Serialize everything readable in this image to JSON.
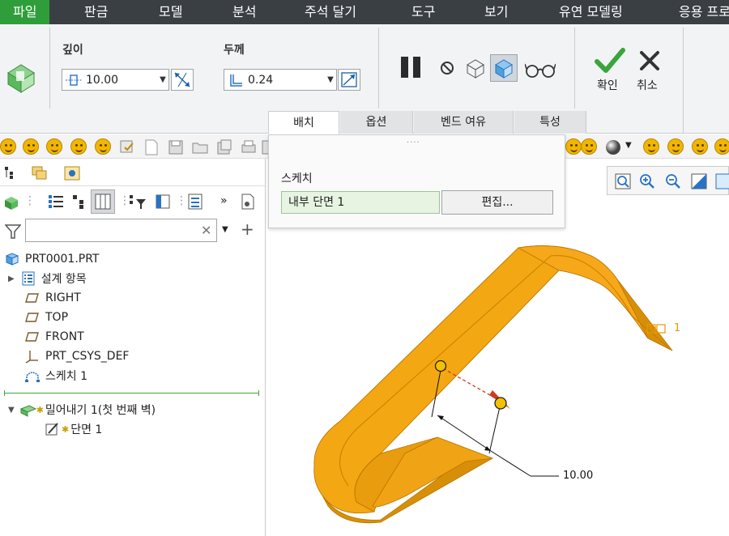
{
  "menubar": {
    "items": [
      "파일",
      "판금",
      "모델",
      "분석",
      "주석 달기",
      "도구",
      "보기",
      "유연 모델링",
      "응용 프로"
    ]
  },
  "ribbon": {
    "depth_label": "깊이",
    "depth_value": "10.00",
    "thickness_label": "두께",
    "thickness_value": "0.24",
    "ok_label": "확인",
    "cancel_label": "취소",
    "tabs": [
      "배치",
      "옵션",
      "벤드 여유",
      "특성"
    ]
  },
  "placement_panel": {
    "sketch_label": "스케치",
    "sketch_value": "내부 단면 1",
    "edit_button": "편집..."
  },
  "model_tree": {
    "filter_placeholder": "",
    "items": [
      {
        "label": "PRT0001.PRT",
        "icon": "part-icon"
      },
      {
        "label": "설계 항목",
        "icon": "design-items-icon"
      },
      {
        "label": "RIGHT",
        "icon": "datum-plane-icon"
      },
      {
        "label": "TOP",
        "icon": "datum-plane-icon"
      },
      {
        "label": "FRONT",
        "icon": "datum-plane-icon"
      },
      {
        "label": "PRT_CSYS_DEF",
        "icon": "csys-icon"
      },
      {
        "label": "스케치 1",
        "icon": "sketch-icon"
      },
      {
        "label": "밀어내기 1(첫 번째 벽)",
        "icon": "extrude-wall-icon"
      },
      {
        "label": "단면 1",
        "icon": "section-icon"
      }
    ]
  },
  "viewport": {
    "dimension_value": "10.00",
    "edge_label": "1"
  },
  "colors": {
    "menubar": "#3a3f44",
    "active_menu": "#2f9e3a",
    "model_orange": "#f3a712",
    "accent_green": "#2f9e3a"
  }
}
